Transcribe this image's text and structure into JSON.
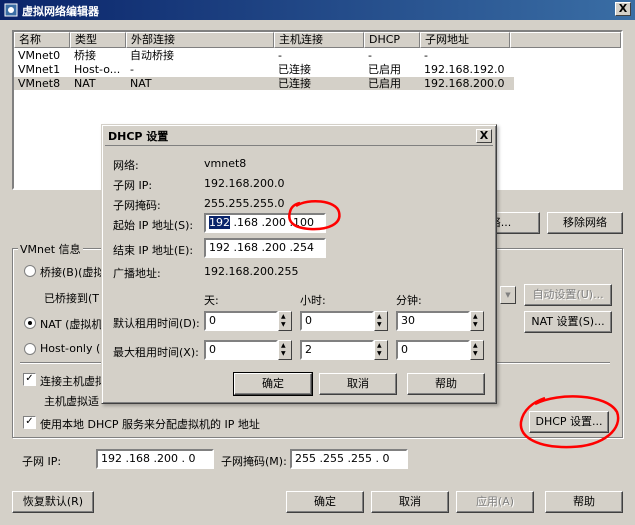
{
  "window": {
    "title": "虚拟网络编辑器",
    "close": "X"
  },
  "table": {
    "headers": [
      "名称",
      "类型",
      "外部连接",
      "主机连接",
      "DHCP",
      "子网地址"
    ],
    "rows": [
      [
        "VMnet0",
        "桥接",
        "自动桥接",
        "-",
        "-",
        "-"
      ],
      [
        "VMnet1",
        "Host-o...",
        "-",
        "已连接",
        "已启用",
        "192.168.192.0"
      ],
      [
        "VMnet8",
        "NAT",
        "NAT",
        "已连接",
        "已启用",
        "192.168.200.0"
      ]
    ],
    "selected_row": 2
  },
  "main": {
    "add_network_button": "添加网络(E)...",
    "add_network_visible": "网络...",
    "remove_network_button": "移除网络",
    "group_title": "VMnet 信息",
    "bridge_radio": "桥接(B)(虚拟",
    "bridged_to_label": "已桥接到(T",
    "auto_settings_button": "自动设置(U)...",
    "nat_radio": "NAT (虚拟机",
    "nat_settings_button": "NAT 设置(S)...",
    "hostonly_radio": "Host-only (",
    "connect_host_check": "连接主机虚拟",
    "host_adapter_label": "主机虚拟适",
    "use_dhcp_check": "使用本地 DHCP 服务来分配虚拟机的 IP 地址",
    "dhcp_settings_button": "DHCP 设置...",
    "subnet_ip_label": "子网 IP:",
    "subnet_ip_value": "192 .168 .200 .  0",
    "subnet_mask_label": "子网掩码(M):",
    "subnet_mask_value": "255 .255 .255 .  0",
    "restore_button": "恢复默认(R)",
    "ok_button": "确定",
    "cancel_button": "取消",
    "apply_button": "应用(A)",
    "help_button": "帮助"
  },
  "dhcp": {
    "title": "DHCP 设置",
    "close": "X",
    "network_label": "网络:",
    "network_value": "vmnet8",
    "subnet_ip_label": "子网 IP:",
    "subnet_ip_value": "192.168.200.0",
    "subnet_mask_label": "子网掩码:",
    "subnet_mask_value": "255.255.255.0",
    "start_ip_label": "起始 IP 地址(S):",
    "start_ip_first": "192",
    "start_ip_rest": " .168 .200 ",
    "start_ip_last": ".100",
    "end_ip_label": "结束 IP 地址(E):",
    "end_ip_value": "192 .168 .200 .254",
    "broadcast_label": "广播地址:",
    "broadcast_value": "192.168.200.255",
    "days_header": "天:",
    "hours_header": "小时:",
    "minutes_header": "分钟:",
    "default_lease_label": "默认租用时间(D):",
    "default_lease": [
      "0",
      "0",
      "30"
    ],
    "max_lease_label": "最大租用时间(X):",
    "max_lease": [
      "0",
      "2",
      "0"
    ],
    "ok_button": "确定",
    "cancel_button": "取消",
    "help_button": "帮助"
  },
  "colors": {
    "annotation": "#ff0000",
    "selection": "#0a246a",
    "face": "#d4d0c8"
  }
}
